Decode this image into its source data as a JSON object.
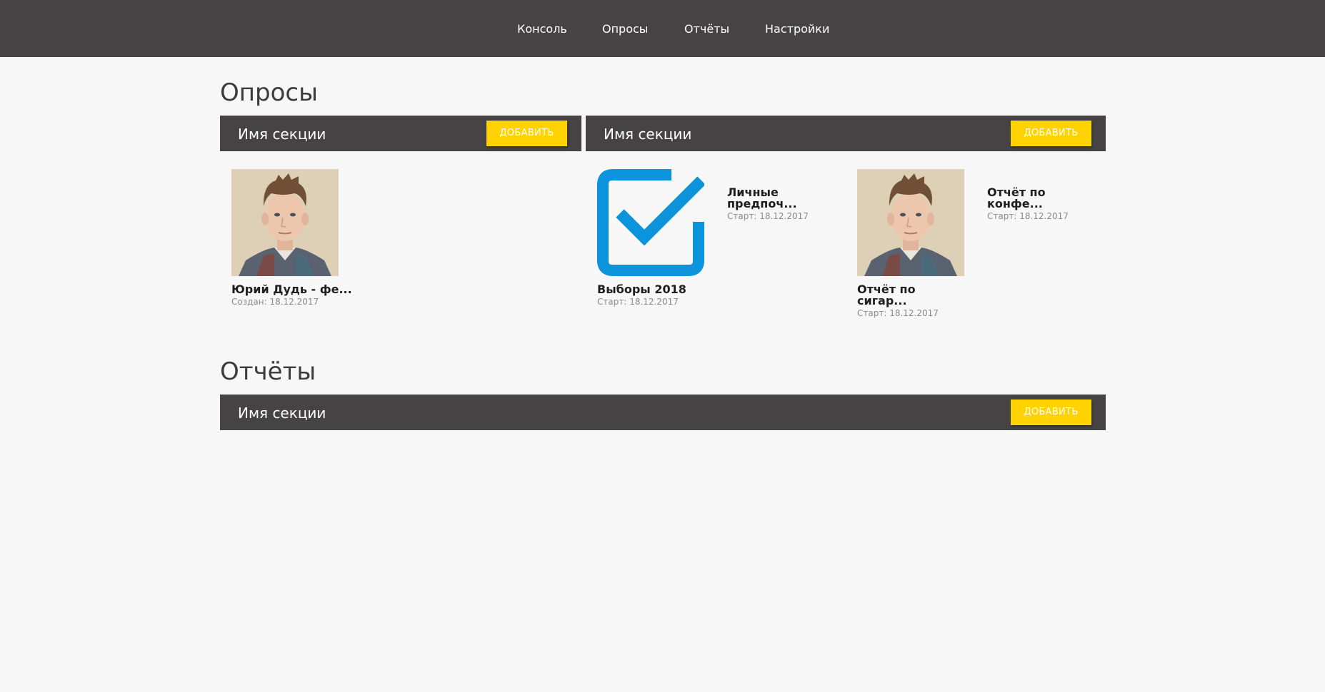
{
  "nav": {
    "items": [
      {
        "label": "Консоль"
      },
      {
        "label": "Опросы"
      },
      {
        "label": "Отчёты"
      },
      {
        "label": "Настройки"
      }
    ]
  },
  "surveys": {
    "heading": "Опросы",
    "sections": [
      {
        "name": "Имя секции",
        "add_label": "ДОБАВИТЬ"
      },
      {
        "name": "Имя секции",
        "add_label": "ДОБАВИТЬ"
      }
    ],
    "cards": [
      {
        "title": "Юрий Дудь - фе...",
        "date": "Создан: 18.12.2017",
        "thumb": "portrait-photo"
      },
      {
        "title": "Выборы 2018",
        "date": "Старт: 18.12.2017",
        "thumb": "checkbox-check-icon"
      },
      {
        "title": "Личные предпоч...",
        "date": "Старт: 18.12.2017",
        "thumb": ""
      },
      {
        "title": "Отчёт по сигар...",
        "date": "Старт: 18.12.2017",
        "thumb": "portrait-photo"
      },
      {
        "title": "Отчёт по конфе...",
        "date": "Старт: 18.12.2017",
        "thumb": ""
      }
    ]
  },
  "reports": {
    "heading": "Отчёты",
    "sections": [
      {
        "name": "Имя секции",
        "add_label": "ДОБАВИТЬ"
      }
    ]
  },
  "colors": {
    "header_bg": "#454344",
    "page_bg": "#f7f7f7",
    "accent_button": "#ffd200",
    "icon_blue": "#0b93dc"
  }
}
